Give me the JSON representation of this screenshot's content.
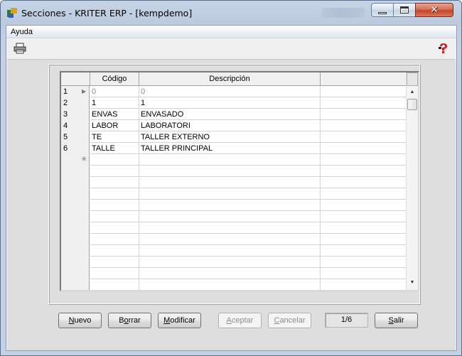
{
  "window": {
    "title": "Secciones - KRITER ERP - [kempdemo]",
    "icon": "kriter-app-icon",
    "controls": [
      "minimize",
      "maximize",
      "close"
    ],
    "close_color": "#c8482e"
  },
  "menubar": {
    "items": [
      "Ayuda"
    ]
  },
  "toolbar": {
    "print_icon": "printer-icon",
    "help_icon": "help-icon"
  },
  "grid": {
    "columns": [
      "Código",
      "Descripción"
    ],
    "rows": [
      {
        "num": "1",
        "codigo": "0",
        "descripcion": "0",
        "current": true
      },
      {
        "num": "2",
        "codigo": "1",
        "descripcion": "1"
      },
      {
        "num": "3",
        "codigo": "ENVAS",
        "descripcion": "ENVASADO"
      },
      {
        "num": "4",
        "codigo": "LABOR",
        "descripcion": "LABORATORI"
      },
      {
        "num": "5",
        "codigo": "TE",
        "descripcion": "TALLER EXTERNO"
      },
      {
        "num": "6",
        "codigo": "TALLE",
        "descripcion": "TALLER PRINCIPAL"
      }
    ],
    "new_row_marker": "✳"
  },
  "buttons": {
    "nuevo": "Nuevo",
    "borrar": "Borrar",
    "modificar": "Modificar",
    "aceptar": "Aceptar",
    "cancelar": "Cancelar",
    "salir": "Salir"
  },
  "record_counter": "1/6"
}
